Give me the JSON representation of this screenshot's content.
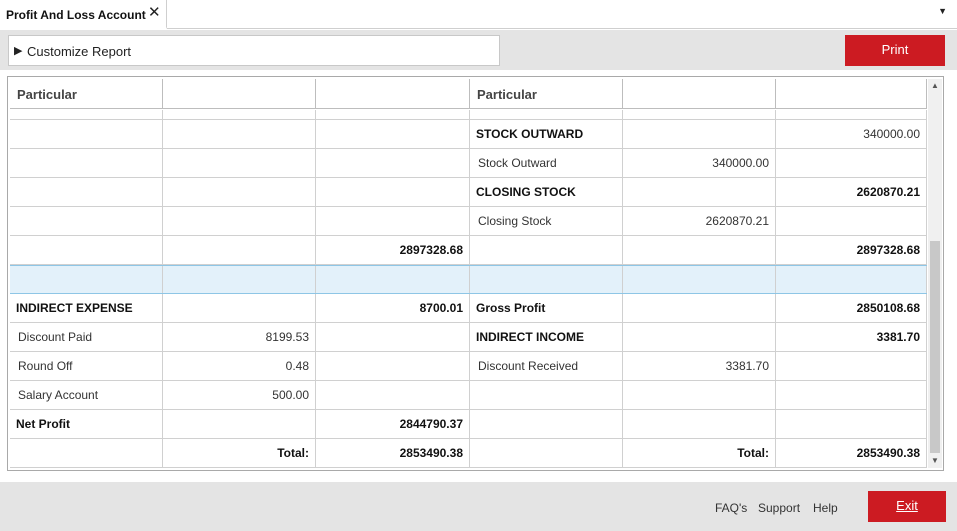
{
  "tab": {
    "title": "Profit And Loss Account",
    "close_icon": "close-icon"
  },
  "toolbar": {
    "customize_label": "Customize Report",
    "print_label": "Print"
  },
  "colors": {
    "accent": "#cc1b22",
    "selected_row": "#e3f1fa",
    "toolbar_bg": "#e4e4e4"
  },
  "grid": {
    "headers": [
      "Particular",
      "",
      "",
      "Particular",
      "",
      ""
    ],
    "rows": [
      {
        "l1": "",
        "l2": "",
        "l3": "",
        "r1": "",
        "r2": "",
        "r3": ""
      },
      {
        "l1": "",
        "l2": "",
        "l3": "",
        "r1": "STOCK OUTWARD",
        "r2": "",
        "r3": "340000.00"
      },
      {
        "l1": "",
        "l2": "",
        "l3": "",
        "r1": "Stock Outward",
        "r2": "340000.00",
        "r3": ""
      },
      {
        "l1": "",
        "l2": "",
        "l3": "",
        "r1": "CLOSING STOCK",
        "r2": "",
        "r3": "2620870.21"
      },
      {
        "l1": "",
        "l2": "",
        "l3": "",
        "r1": "Closing Stock",
        "r2": "2620870.21",
        "r3": ""
      },
      {
        "l1": "",
        "l2": "",
        "l3": "2897328.68",
        "r1": "",
        "r2": "",
        "r3": "2897328.68"
      },
      {
        "l1": "",
        "l2": "",
        "l3": "",
        "r1": "",
        "r2": "",
        "r3": ""
      },
      {
        "l1": "INDIRECT EXPENSE",
        "l2": "",
        "l3": "8700.01",
        "r1": "Gross Profit",
        "r2": "",
        "r3": "2850108.68"
      },
      {
        "l1": "Discount Paid",
        "l2": "8199.53",
        "l3": "",
        "r1": "INDIRECT INCOME",
        "r2": "",
        "r3": "3381.70"
      },
      {
        "l1": "Round Off",
        "l2": "0.48",
        "l3": "",
        "r1": "Discount Received",
        "r2": "3381.70",
        "r3": ""
      },
      {
        "l1": "Salary Account",
        "l2": "500.00",
        "l3": "",
        "r1": "",
        "r2": "",
        "r3": ""
      },
      {
        "l1": "Net Profit",
        "l2": "",
        "l3": "2844790.37",
        "r1": "",
        "r2": "",
        "r3": ""
      },
      {
        "l1": "",
        "l2": "Total:",
        "l3": "2853490.38",
        "r1": "",
        "r2": "Total:",
        "r3": "2853490.38"
      }
    ]
  },
  "footer": {
    "faq_label": "FAQ's",
    "support_label": "Support",
    "help_label": "Help",
    "exit_label": "Exit"
  }
}
